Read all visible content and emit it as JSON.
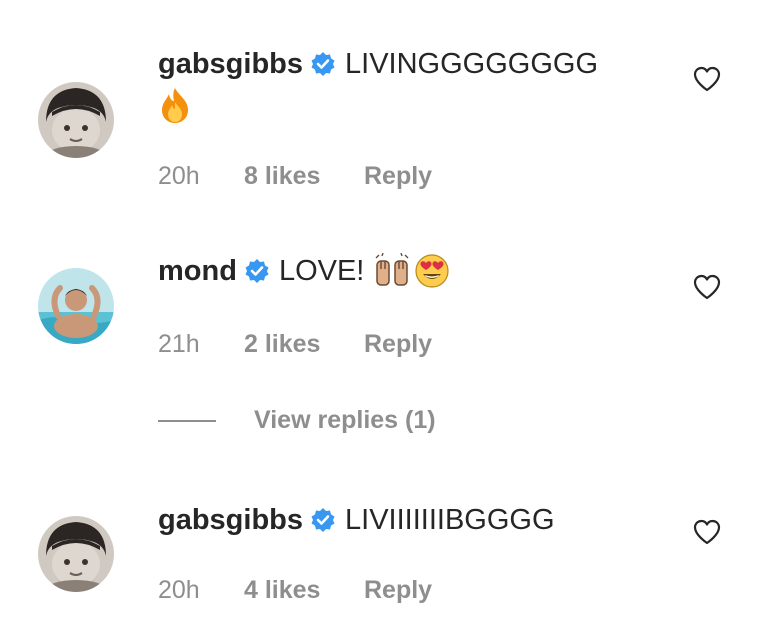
{
  "comments": [
    {
      "username": "gabsgibbs",
      "verified": true,
      "text": "LIVINGGGGGGGG",
      "emoji": "fire-emoji",
      "time": "20h",
      "likes": "8 likes",
      "reply": "Reply"
    },
    {
      "username": "mond",
      "verified": true,
      "text": "LOVE!",
      "emoji": "raised-hands-emoji heart-eyes-emoji",
      "time": "21h",
      "likes": "2 likes",
      "reply": "Reply"
    },
    {
      "username": "gabsgibbs",
      "verified": true,
      "text": "LIVIIIIIIIBGGGG",
      "time": "20h",
      "likes": "4 likes",
      "reply": "Reply"
    }
  ],
  "view_replies": "View replies (1)",
  "colors": {
    "text": "#262626",
    "muted": "#8e8e8e",
    "verified": "#3897f0"
  }
}
